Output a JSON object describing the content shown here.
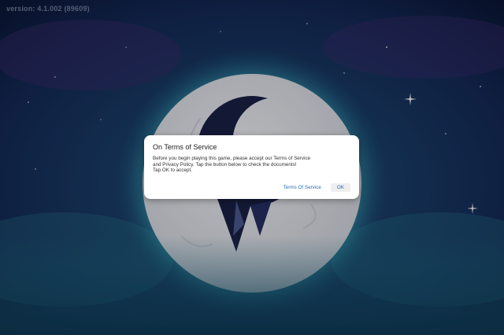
{
  "version_label": "version: 4.1.002 (89609)",
  "dialog": {
    "title": "On Terms of Service",
    "body_lines": [
      "Before you begin playing this game, please accept our Terms of Service",
      "and Privacy Policy. Tap the button below to check the documents!",
      "Tap OK to accept."
    ],
    "terms_button_label": "Terms Of Service",
    "ok_button_label": "OK"
  },
  "colors": {
    "link": "#2a6fb8",
    "dialog_background": "#ffffff",
    "moon": "#e8eaf0",
    "sky_top": "#0b1a3a",
    "glow": "#4fd0d8"
  },
  "icons": {
    "crescent_logo": "crescent-moon-emblem"
  }
}
